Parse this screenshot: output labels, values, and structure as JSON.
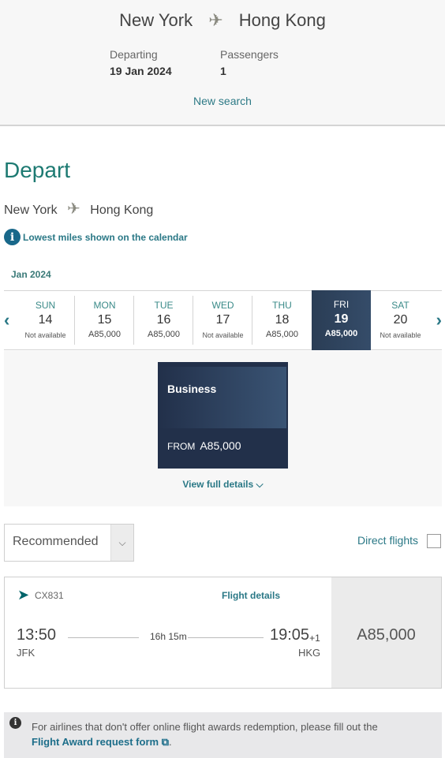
{
  "header": {
    "origin": "New York",
    "destination": "Hong Kong",
    "departing_label": "Departing",
    "departing_value": "19 Jan 2024",
    "passengers_label": "Passengers",
    "passengers_value": "1",
    "new_search": "New search"
  },
  "depart": {
    "title": "Depart",
    "origin": "New York",
    "destination": "Hong Kong",
    "info_text": "Lowest miles shown on the calendar",
    "month": "Jan 2024"
  },
  "calendar": {
    "days": [
      {
        "dow": "SUN",
        "num": "14",
        "price": "Not available",
        "available": false
      },
      {
        "dow": "MON",
        "num": "15",
        "price": "A85,000",
        "available": true
      },
      {
        "dow": "TUE",
        "num": "16",
        "price": "A85,000",
        "available": true
      },
      {
        "dow": "WED",
        "num": "17",
        "price": "Not available",
        "available": false
      },
      {
        "dow": "THU",
        "num": "18",
        "price": "A85,000",
        "available": true
      },
      {
        "dow": "FRI",
        "num": "19",
        "price": "A85,000",
        "available": true,
        "selected": true
      },
      {
        "dow": "SAT",
        "num": "20",
        "price": "Not available",
        "available": false
      }
    ]
  },
  "cabin": {
    "name": "Business",
    "from_label": "FROM",
    "price": "A85,000",
    "view_details": "View full details"
  },
  "filters": {
    "sort_value": "Recommended",
    "direct_label": "Direct flights",
    "direct_checked": false
  },
  "flight": {
    "number": "CX831",
    "details_link": "Flight details",
    "dep_time": "13:50",
    "dep_airport": "JFK",
    "duration": "16h 15m",
    "arr_time": "19:05",
    "arr_offset": "+1",
    "arr_airport": "HKG",
    "price": "A85,000"
  },
  "notice": {
    "text": "For airlines that don't offer online flight awards redemption, please fill out the",
    "link": "Flight Award request form",
    "suffix": "."
  }
}
